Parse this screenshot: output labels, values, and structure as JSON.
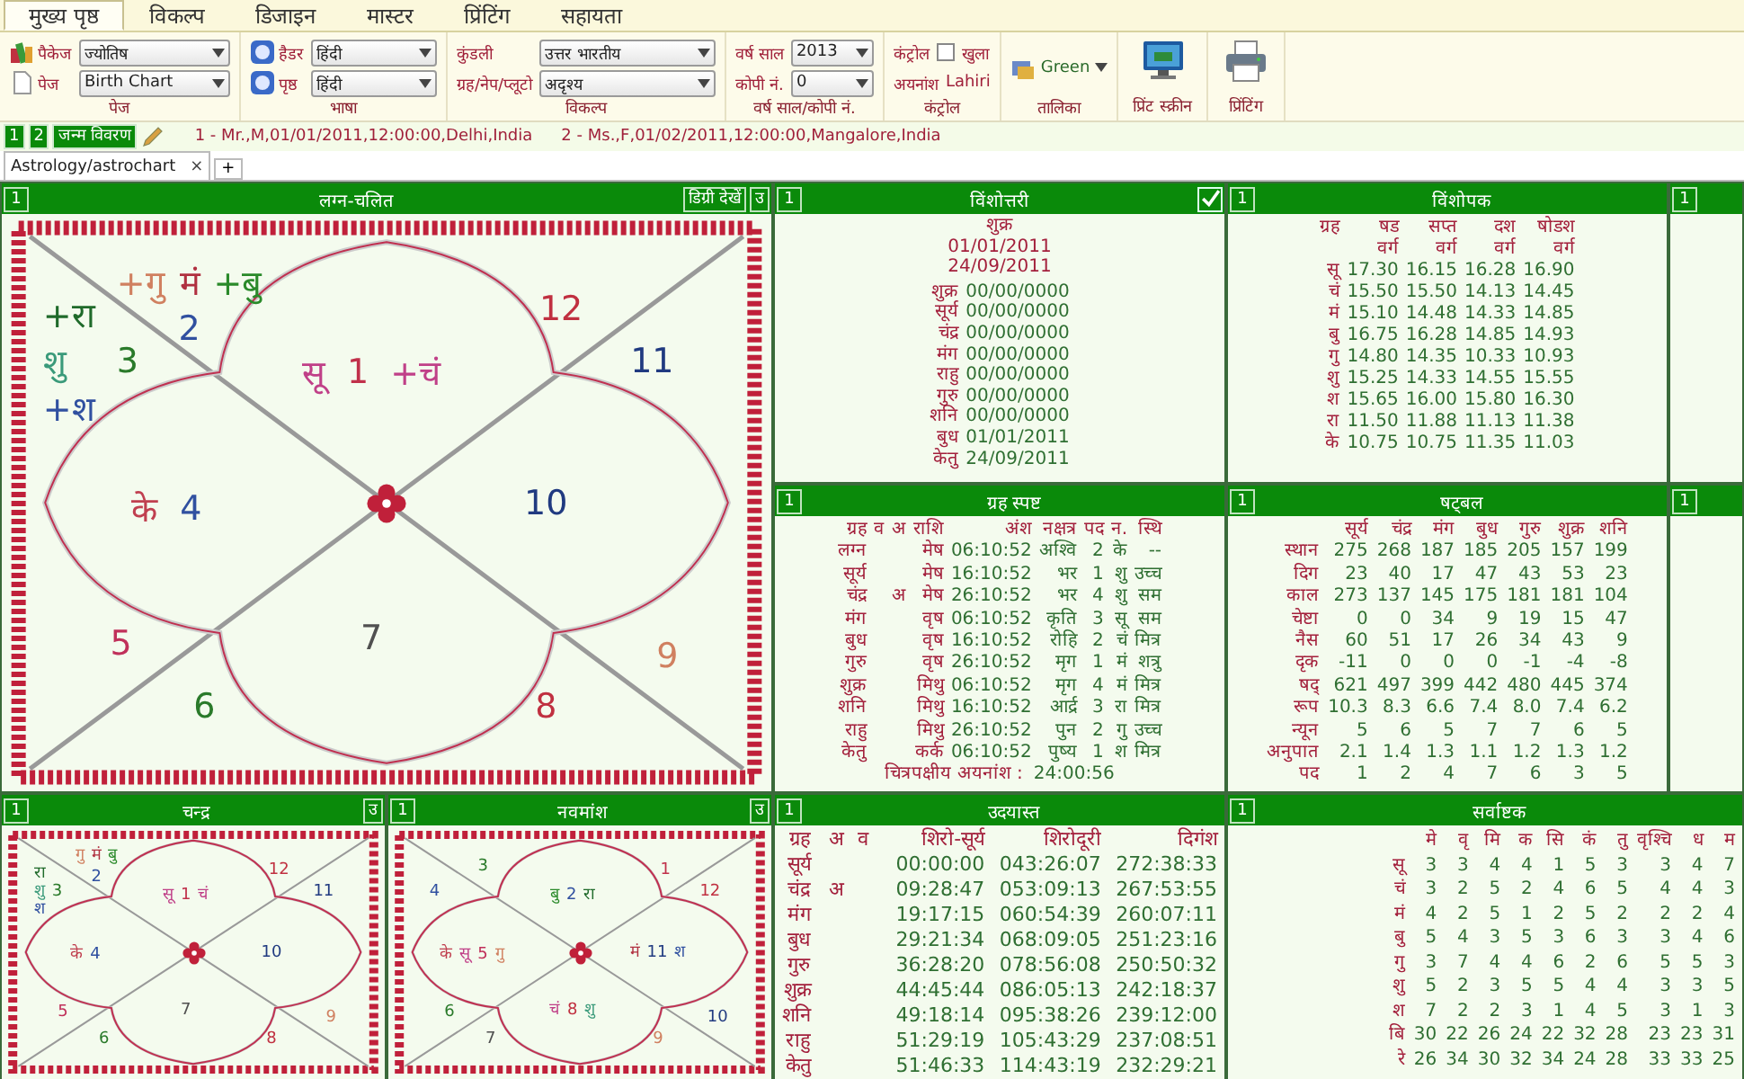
{
  "menu_tabs": [
    {
      "label": "मुख्य पृष्ठ",
      "selected": true
    },
    {
      "label": "विकल्प",
      "selected": false
    },
    {
      "label": "डिजाइन",
      "selected": false
    },
    {
      "label": "मास्टर",
      "selected": false
    },
    {
      "label": "प्रिंटिंग",
      "selected": false
    },
    {
      "label": "सहायता",
      "selected": false
    }
  ],
  "ribbon": [
    {
      "kind": "fields",
      "label": "पेज",
      "fields": [
        {
          "label": "पैकेज",
          "value": "ज्योतिष"
        },
        {
          "label": "पेज",
          "value": "Birth Chart"
        }
      ]
    },
    {
      "kind": "fields",
      "label": "भाषा",
      "fields": [
        {
          "label": "हैडर",
          "value": "हिंदी"
        },
        {
          "label": "पृष्ठ",
          "value": "हिंदी"
        }
      ]
    },
    {
      "kind": "fields",
      "label": "विकल्प",
      "fields": [
        {
          "label": "कुंडली",
          "value": "उत्तर भारतीय"
        },
        {
          "label": "ग्रह/नेप/प्लूटो",
          "value": "अदृश्य"
        }
      ]
    },
    {
      "kind": "fields",
      "label": "वर्ष साल/कोपी नं.",
      "fields": [
        {
          "label": "वर्ष साल",
          "value": "2013"
        },
        {
          "label": "कोपी नं.",
          "value": "0"
        }
      ]
    },
    {
      "kind": "control",
      "label": "कंट्रोल",
      "title": "कंट्रोल",
      "checkbox": {
        "label": "खुला",
        "checked": false
      },
      "ayanamsha_label": "अयनांश",
      "ayanamsha_value": "Lahiri"
    },
    {
      "kind": "theme",
      "label": "तालिका",
      "value": "Green"
    },
    {
      "kind": "screen_button",
      "label": "प्रिंट स्क्रीन"
    },
    {
      "kind": "print_button",
      "label": "प्रिंटिंग"
    }
  ],
  "profile_buttons": [
    "1",
    "2",
    "जन्म विवरण"
  ],
  "profiles": [
    "1 - Mr.,M,01/01/2011,12:00:00,Delhi,India",
    "2 - Ms.,F,01/02/2011,12:00:00,Mangalore,India"
  ],
  "doc_tabs": [
    {
      "label": "Astrology/astrochart",
      "selected": true,
      "close": "×"
    }
  ],
  "add_tab": "+",
  "lagna_chart": {
    "index": "1",
    "title": "लग्न-चलित",
    "buttons": [
      "डिग्री देखें",
      "उ"
    ],
    "houses": [
      {
        "number": "1",
        "color": "#c0304a",
        "planets": [
          {
            "text": "सू",
            "color": "#c04088"
          },
          {
            "text": "+चं",
            "color": "#c04088"
          }
        ]
      },
      {
        "number": "2",
        "color": "#3050a0",
        "planets": [
          {
            "text": "+गु",
            "color": "#d08060"
          },
          {
            "text": "मं",
            "color": "#b03040"
          },
          {
            "text": "+बु",
            "color": "#2a8a2a"
          }
        ]
      },
      {
        "number": "3",
        "color": "#2a7a2a",
        "planets": [
          {
            "text": "+रा",
            "color": "#1f6a2a"
          },
          {
            "text": "शु",
            "color": "#3a9a7a"
          },
          {
            "text": "+श",
            "color": "#3050a0"
          }
        ]
      },
      {
        "number": "4",
        "color": "#3050a0",
        "planets": [
          {
            "text": "के",
            "color": "#c04050"
          }
        ]
      },
      {
        "number": "5",
        "color": "#c0305a"
      },
      {
        "number": "6",
        "color": "#2a7a2a"
      },
      {
        "number": "7",
        "color": "#505050"
      },
      {
        "number": "8",
        "color": "#c03040"
      },
      {
        "number": "9",
        "color": "#d08060"
      },
      {
        "number": "10",
        "color": "#203a80"
      },
      {
        "number": "11",
        "color": "#203a80"
      },
      {
        "number": "12",
        "color": "#c03040"
      }
    ]
  },
  "chandra_chart": {
    "index": "1",
    "title": "चन्द्र",
    "buttons": [
      "उ"
    ],
    "houses": [
      {
        "number": "1",
        "color": "#c0304a",
        "planets": [
          {
            "text": "सू",
            "color": "#c04088"
          },
          {
            "text": "चं",
            "color": "#c04088"
          }
        ]
      },
      {
        "number": "2",
        "color": "#3050a0",
        "planets": [
          {
            "text": "गु",
            "color": "#d08060"
          },
          {
            "text": "मं",
            "color": "#b03040"
          },
          {
            "text": "बु",
            "color": "#2a8a2a"
          }
        ]
      },
      {
        "number": "3",
        "color": "#2a7a2a",
        "planets": [
          {
            "text": "रा",
            "color": "#1f6a2a"
          },
          {
            "text": "शु",
            "color": "#3a9a7a"
          },
          {
            "text": "श",
            "color": "#3050a0"
          }
        ]
      },
      {
        "number": "4",
        "color": "#3050a0",
        "planets": [
          {
            "text": "के",
            "color": "#c04050"
          }
        ]
      },
      {
        "number": "5",
        "color": "#c0305a"
      },
      {
        "number": "6",
        "color": "#2a7a2a"
      },
      {
        "number": "7",
        "color": "#505050"
      },
      {
        "number": "8",
        "color": "#c03040"
      },
      {
        "number": "9",
        "color": "#d08060"
      },
      {
        "number": "10",
        "color": "#203a80"
      },
      {
        "number": "11",
        "color": "#203a80"
      },
      {
        "number": "12",
        "color": "#c03040"
      }
    ]
  },
  "navamsha_chart": {
    "index": "1",
    "title": "नवमांश",
    "buttons": [
      "उ"
    ],
    "houses": [
      {
        "number": "2",
        "color": "#3050a0",
        "planets": [
          {
            "text": "बु",
            "color": "#2a8a2a"
          },
          {
            "text": "रा",
            "color": "#1f6a2a"
          }
        ]
      },
      {
        "number": "3",
        "color": "#2a7a2a"
      },
      {
        "number": "4",
        "color": "#3050a0"
      },
      {
        "number": "5",
        "color": "#c0305a",
        "planets": [
          {
            "text": "के",
            "color": "#c04050"
          },
          {
            "text": "सू",
            "color": "#c04088"
          },
          {
            "text": "गु",
            "color": "#d08060"
          }
        ]
      },
      {
        "number": "6",
        "color": "#2a7a2a"
      },
      {
        "number": "7",
        "color": "#505050"
      },
      {
        "number": "8",
        "color": "#c03040",
        "planets": [
          {
            "text": "चं",
            "color": "#c04088"
          },
          {
            "text": "शु",
            "color": "#3a9a7a"
          }
        ]
      },
      {
        "number": "9",
        "color": "#d08060"
      },
      {
        "number": "10",
        "color": "#203a80"
      },
      {
        "number": "11",
        "color": "#203a80",
        "planets": [
          {
            "text": "मं",
            "color": "#b03040"
          },
          {
            "text": "श",
            "color": "#3050a0"
          }
        ]
      },
      {
        "number": "12",
        "color": "#c03040"
      },
      {
        "number": "1",
        "color": "#c0304a"
      }
    ]
  },
  "vimshottari": {
    "index": "1",
    "title": "विंशोत्तरी",
    "checked": true,
    "mahadasha": "शुक्र",
    "start": "01/01/2011",
    "end": "24/09/2011",
    "rows": [
      {
        "planet": "शुक्र",
        "date": "00/00/0000"
      },
      {
        "planet": "सूर्य",
        "date": "00/00/0000"
      },
      {
        "planet": "चंद्र",
        "date": "00/00/0000"
      },
      {
        "planet": "मंग",
        "date": "00/00/0000"
      },
      {
        "planet": "राहु",
        "date": "00/00/0000"
      },
      {
        "planet": "गुरु",
        "date": "00/00/0000"
      },
      {
        "planet": "शनि",
        "date": "00/00/0000"
      },
      {
        "planet": "बुध",
        "date": "01/01/2011"
      },
      {
        "planet": "केतु",
        "date": "24/09/2011"
      }
    ]
  },
  "vishopak": {
    "index": "1",
    "title": "विंशोपक",
    "first_header": "ग्रह",
    "columns": [
      {
        "top": "षड",
        "bottom": "वर्ग"
      },
      {
        "top": "सप्त",
        "bottom": "वर्ग"
      },
      {
        "top": "दश",
        "bottom": "वर्ग"
      },
      {
        "top": "षोडश",
        "bottom": "वर्ग"
      }
    ],
    "rows": [
      {
        "planet": "सू",
        "values": [
          "17.30",
          "16.15",
          "16.28",
          "16.90"
        ]
      },
      {
        "planet": "चं",
        "values": [
          "15.50",
          "15.50",
          "14.13",
          "14.45"
        ]
      },
      {
        "planet": "मं",
        "values": [
          "15.10",
          "14.48",
          "14.33",
          "14.85"
        ]
      },
      {
        "planet": "बु",
        "values": [
          "16.75",
          "16.28",
          "14.85",
          "14.93"
        ]
      },
      {
        "planet": "गु",
        "values": [
          "14.80",
          "14.35",
          "10.33",
          "10.93"
        ]
      },
      {
        "planet": "शु",
        "values": [
          "15.25",
          "14.33",
          "14.55",
          "15.55"
        ]
      },
      {
        "planet": "श",
        "values": [
          "15.65",
          "16.00",
          "15.80",
          "16.30"
        ]
      },
      {
        "planet": "रा",
        "values": [
          "11.50",
          "11.88",
          "11.13",
          "11.38"
        ]
      },
      {
        "planet": "के",
        "values": [
          "10.75",
          "10.75",
          "11.35",
          "11.03"
        ]
      }
    ]
  },
  "side_panels": [
    {
      "index": "1"
    },
    {
      "index": "1"
    }
  ],
  "graha_spasht": {
    "index": "1",
    "title": "ग्रह स्पष्ट",
    "columns": [
      "ग्रह",
      "व",
      "अ",
      "राशि",
      "अंश",
      "नक्षत्र",
      "पद",
      "न.",
      "स्थि"
    ],
    "rows": [
      {
        "planet": "लग्न",
        "sign": "मेष",
        "degree": "06:10:52",
        "nakshatra": "अश्वि",
        "pada": "2",
        "lord": "के",
        "status": "--"
      },
      {
        "planet": "सूर्य",
        "sign": "मेष",
        "degree": "16:10:52",
        "nakshatra": "भर",
        "pada": "1",
        "lord": "शु",
        "status": "उच्च"
      },
      {
        "planet": "चंद्र",
        "combust": "अ",
        "sign": "मेष",
        "degree": "26:10:52",
        "nakshatra": "भर",
        "pada": "4",
        "lord": "शु",
        "status": "सम"
      },
      {
        "planet": "मंग",
        "sign": "वृष",
        "degree": "06:10:52",
        "nakshatra": "कृति",
        "pada": "3",
        "lord": "सू",
        "status": "सम"
      },
      {
        "planet": "बुध",
        "sign": "वृष",
        "degree": "16:10:52",
        "nakshatra": "रोहि",
        "pada": "2",
        "lord": "चं",
        "status": "मित्र"
      },
      {
        "planet": "गुरु",
        "sign": "वृष",
        "degree": "26:10:52",
        "nakshatra": "मृग",
        "pada": "1",
        "lord": "मं",
        "status": "शत्रु"
      },
      {
        "planet": "शुक्र",
        "sign": "मिथु",
        "degree": "06:10:52",
        "nakshatra": "मृग",
        "pada": "4",
        "lord": "मं",
        "status": "मित्र"
      },
      {
        "planet": "शनि",
        "sign": "मिथु",
        "degree": "16:10:52",
        "nakshatra": "आर्द्र",
        "pada": "3",
        "lord": "रा",
        "status": "मित्र"
      },
      {
        "planet": "राहु",
        "sign": "मिथु",
        "degree": "26:10:52",
        "nakshatra": "पुन",
        "pada": "2",
        "lord": "गु",
        "status": "उच्च"
      },
      {
        "planet": "केतु",
        "sign": "कर्क",
        "degree": "06:10:52",
        "nakshatra": "पुष्य",
        "pada": "1",
        "lord": "श",
        "status": "मित्र"
      }
    ],
    "footer_label": "चित्रपक्षीय अयनांश :",
    "footer_value": "24:00:56"
  },
  "shadbal": {
    "index": "1",
    "title": "षट्बल",
    "columns": [
      "सूर्य",
      "चंद्र",
      "मंग",
      "बुध",
      "गुरु",
      "शुक्र",
      "शनि"
    ],
    "rows": [
      {
        "label": "स्थान",
        "values": [
          "275",
          "268",
          "187",
          "185",
          "205",
          "157",
          "199"
        ]
      },
      {
        "label": "दिग",
        "values": [
          "23",
          "40",
          "17",
          "47",
          "43",
          "53",
          "23"
        ]
      },
      {
        "label": "काल",
        "values": [
          "273",
          "137",
          "145",
          "175",
          "181",
          "181",
          "104"
        ]
      },
      {
        "label": "चेष्टा",
        "values": [
          "0",
          "0",
          "34",
          "9",
          "19",
          "15",
          "47"
        ]
      },
      {
        "label": "नैस",
        "values": [
          "60",
          "51",
          "17",
          "26",
          "34",
          "43",
          "9"
        ]
      },
      {
        "label": "दृक",
        "values": [
          "-11",
          "0",
          "0",
          "0",
          "-1",
          "-4",
          "-8"
        ]
      },
      {
        "label": "षद्",
        "values": [
          "621",
          "497",
          "399",
          "442",
          "480",
          "445",
          "374"
        ]
      },
      {
        "label": "रूप",
        "values": [
          "10.3",
          "8.3",
          "6.6",
          "7.4",
          "8.0",
          "7.4",
          "6.2"
        ]
      },
      {
        "label": "न्यून",
        "values": [
          "5",
          "6",
          "5",
          "7",
          "7",
          "6",
          "5"
        ]
      },
      {
        "label": "अनुपात",
        "values": [
          "2.1",
          "1.4",
          "1.3",
          "1.1",
          "1.2",
          "1.3",
          "1.2"
        ]
      },
      {
        "label": "पद",
        "values": [
          "1",
          "2",
          "4",
          "7",
          "6",
          "3",
          "5"
        ]
      }
    ]
  },
  "udayast": {
    "index": "1",
    "title": "उदयास्त",
    "columns": [
      "ग्रह",
      "अ",
      "व",
      "शिरो-सूर्य",
      "शिरोदूरी",
      "दिगंश"
    ],
    "rows": [
      {
        "planet": "सूर्य",
        "values": [
          "00:00:00",
          "043:26:07",
          "272:38:33"
        ]
      },
      {
        "planet": "चंद्र",
        "combust": "अ",
        "values": [
          "09:28:47",
          "053:09:13",
          "267:53:55"
        ]
      },
      {
        "planet": "मंग",
        "values": [
          "19:17:15",
          "060:54:39",
          "260:07:11"
        ]
      },
      {
        "planet": "बुध",
        "values": [
          "29:21:34",
          "068:09:05",
          "251:23:16"
        ]
      },
      {
        "planet": "गुरु",
        "values": [
          "36:28:20",
          "078:56:08",
          "250:50:32"
        ]
      },
      {
        "planet": "शुक्र",
        "values": [
          "44:45:44",
          "086:05:13",
          "242:18:37"
        ]
      },
      {
        "planet": "शनि",
        "values": [
          "49:18:14",
          "095:38:26",
          "239:12:00"
        ]
      },
      {
        "planet": "राहु",
        "values": [
          "51:29:19",
          "105:43:29",
          "237:08:51"
        ]
      },
      {
        "planet": "केतु",
        "values": [
          "51:46:33",
          "114:43:19",
          "232:29:21"
        ]
      }
    ]
  },
  "sarvashtak": {
    "index": "1",
    "title": "सर्वाष्टक",
    "columns": [
      "मे",
      "वृ",
      "मि",
      "क",
      "सि",
      "कं",
      "तु",
      "वृश्चि",
      "ध",
      "म"
    ],
    "rows": [
      {
        "label": "सू",
        "values": [
          "3",
          "3",
          "4",
          "4",
          "1",
          "5",
          "3",
          "3",
          "4",
          "7"
        ]
      },
      {
        "label": "चं",
        "values": [
          "3",
          "2",
          "5",
          "2",
          "4",
          "6",
          "5",
          "4",
          "4",
          "3"
        ]
      },
      {
        "label": "मं",
        "values": [
          "4",
          "2",
          "5",
          "1",
          "2",
          "5",
          "2",
          "2",
          "2",
          "4"
        ]
      },
      {
        "label": "बु",
        "values": [
          "5",
          "4",
          "3",
          "5",
          "3",
          "6",
          "3",
          "3",
          "4",
          "6"
        ]
      },
      {
        "label": "गु",
        "values": [
          "3",
          "7",
          "4",
          "4",
          "6",
          "2",
          "6",
          "5",
          "5",
          "3"
        ]
      },
      {
        "label": "शु",
        "values": [
          "5",
          "2",
          "3",
          "5",
          "5",
          "4",
          "4",
          "3",
          "3",
          "5"
        ]
      },
      {
        "label": "श",
        "values": [
          "7",
          "2",
          "2",
          "3",
          "1",
          "4",
          "5",
          "3",
          "1",
          "3"
        ]
      },
      {
        "label": "बि",
        "values": [
          "30",
          "22",
          "26",
          "24",
          "22",
          "32",
          "28",
          "23",
          "23",
          "31"
        ]
      },
      {
        "label": "रे",
        "values": [
          "26",
          "34",
          "30",
          "32",
          "34",
          "24",
          "28",
          "33",
          "33",
          "25"
        ]
      }
    ]
  }
}
